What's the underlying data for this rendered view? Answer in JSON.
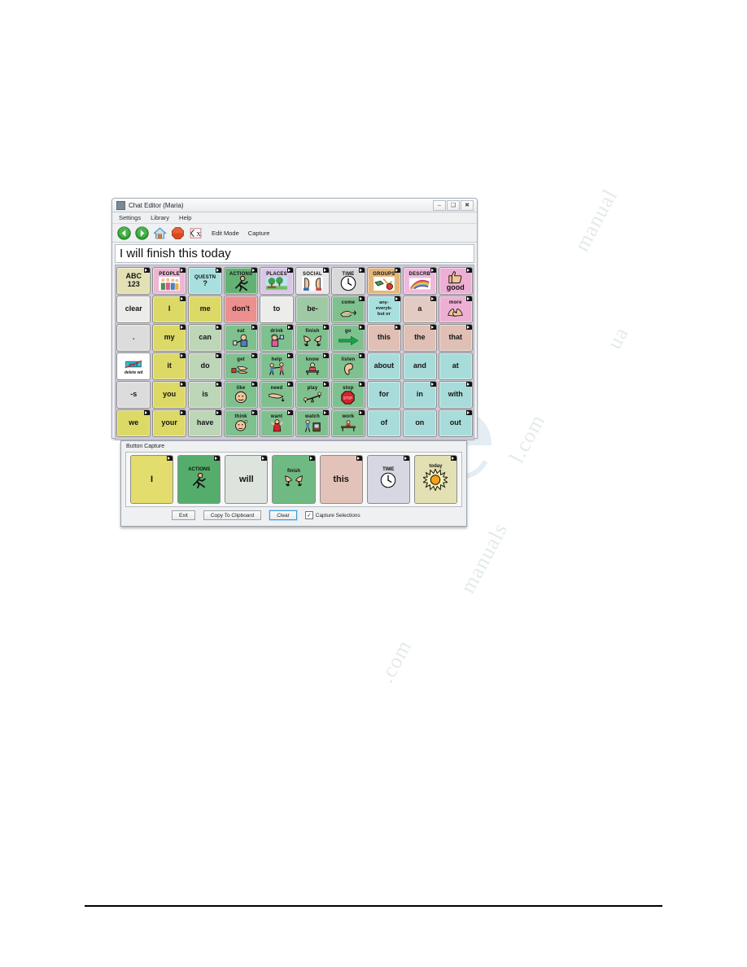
{
  "window": {
    "title": "Chat Editor (Maria)",
    "icon": "chat-editor-icon",
    "controls": {
      "minimize": "–",
      "maximize": "❑",
      "close": "✖"
    },
    "menu": [
      "Settings",
      "Library",
      "Help"
    ],
    "toolbar": {
      "icons": [
        "back-arrow-icon",
        "forward-arrow-icon",
        "home-icon",
        "stop-icon",
        "clear-display-icon"
      ],
      "labels": [
        "Edit Mode",
        "Capture"
      ]
    },
    "message_bar": {
      "text": "I will finish this today"
    }
  },
  "grid": {
    "columns": 10,
    "rows": 6,
    "cells": [
      {
        "label": "ABC",
        "label2": "123",
        "caption": "",
        "art": "",
        "color": "#e3e0b4",
        "corner": true
      },
      {
        "label": "",
        "caption": "PEOPLE",
        "art": "people-icon",
        "color": "#ecb7d2",
        "corner": true
      },
      {
        "label": "?",
        "caption": "QUESTN",
        "art": "",
        "color": "#a8e0df",
        "corner": true
      },
      {
        "label": "",
        "caption": "ACTIONS",
        "art": "running-person-icon",
        "color": "#63b174",
        "corner": true
      },
      {
        "label": "",
        "caption": "PLACES",
        "art": "park-scene-icon",
        "color": "#d9c6e6",
        "corner": true
      },
      {
        "label": "",
        "caption": "SOCIAL",
        "art": "two-faces-icon",
        "color": "#e8e8e8",
        "corner": true
      },
      {
        "label": "",
        "caption": "TIME",
        "art": "clock-icon",
        "color": "#d9d9d9",
        "corner": true
      },
      {
        "label": "",
        "caption": "GROUPS",
        "art": "objects-icon",
        "color": "#e3b77a",
        "corner": true
      },
      {
        "label": "",
        "caption": "DESCRB",
        "art": "rainbow-icon",
        "color": "#eeb9dd",
        "corner": true
      },
      {
        "label": "good",
        "caption": "",
        "art": "thumbs-up-icon",
        "color": "#eeafd4",
        "corner": true
      },
      {
        "label": "clear",
        "caption": "",
        "art": "",
        "color": "#ececeb",
        "corner": false
      },
      {
        "label": "I",
        "caption": "",
        "art": "",
        "color": "#dcd966",
        "corner": true
      },
      {
        "label": "me",
        "caption": "",
        "art": "",
        "color": "#dcd966",
        "corner": false
      },
      {
        "label": "don't",
        "caption": "",
        "art": "",
        "color": "#eb8f8f",
        "corner": false
      },
      {
        "label": "to",
        "caption": "",
        "art": "",
        "color": "#ececeb",
        "corner": false
      },
      {
        "label": "be-",
        "caption": "",
        "art": "",
        "color": "#9fc8a4",
        "corner": false
      },
      {
        "label": "",
        "caption": "come",
        "art": "hand-icon",
        "color": "#7fc08f",
        "corner": true
      },
      {
        "label": "any-\neveryb-\nbut or",
        "caption": "",
        "art": "",
        "color": "#a8e0df",
        "corner": true
      },
      {
        "label": "a",
        "caption": "",
        "art": "",
        "color": "#e3cbc3",
        "corner": true
      },
      {
        "label": "",
        "caption": "more",
        "art": "hands-icon",
        "color": "#eeafd4",
        "corner": true
      },
      {
        "label": ".",
        "caption": "",
        "art": "",
        "color": "#dcdcdc",
        "corner": false
      },
      {
        "label": "my",
        "caption": "",
        "art": "",
        "color": "#dcd966",
        "corner": true
      },
      {
        "label": "can",
        "caption": "",
        "art": "",
        "color": "#bcd6b7",
        "corner": true
      },
      {
        "label": "",
        "caption": "eat",
        "art": "eating-icon",
        "color": "#7fc08f",
        "corner": true
      },
      {
        "label": "",
        "caption": "drink",
        "art": "drinking-icon",
        "color": "#7fc08f",
        "corner": true
      },
      {
        "label": "",
        "caption": "finish",
        "art": "hands-down-icon",
        "color": "#7fc08f",
        "corner": true
      },
      {
        "label": "",
        "caption": "go",
        "art": "green-arrow-icon",
        "color": "#7fc08f",
        "corner": true
      },
      {
        "label": "this",
        "caption": "",
        "art": "",
        "color": "#e0bfb4",
        "corner": true
      },
      {
        "label": "the",
        "caption": "",
        "art": "",
        "color": "#e0bfb4",
        "corner": true
      },
      {
        "label": "that",
        "caption": "",
        "art": "",
        "color": "#e0bfb4",
        "corner": true
      },
      {
        "label": "delete wd",
        "caption": "",
        "art": "delete-word-icon",
        "color": "#ffffff",
        "corner": false
      },
      {
        "label": "it",
        "caption": "",
        "art": "",
        "color": "#dcd966",
        "corner": true
      },
      {
        "label": "do",
        "caption": "",
        "art": "",
        "color": "#bcd6b7",
        "corner": true
      },
      {
        "label": "",
        "caption": "get",
        "art": "grabbing-hands-icon",
        "color": "#7fc08f",
        "corner": true
      },
      {
        "label": "",
        "caption": "help",
        "art": "helping-icon",
        "color": "#7fc08f",
        "corner": true
      },
      {
        "label": "",
        "caption": "know",
        "art": "person-desk-icon",
        "color": "#7fc08f",
        "corner": true
      },
      {
        "label": "",
        "caption": "listen",
        "art": "ear-icon",
        "color": "#7fc08f",
        "corner": true
      },
      {
        "label": "about",
        "caption": "",
        "art": "",
        "color": "#a8dcda",
        "corner": false
      },
      {
        "label": "and",
        "caption": "",
        "art": "",
        "color": "#a8dcda",
        "corner": false
      },
      {
        "label": "at",
        "caption": "",
        "art": "",
        "color": "#a8dcda",
        "corner": false
      },
      {
        "label": "-s",
        "caption": "",
        "art": "",
        "color": "#dcdcdc",
        "corner": false
      },
      {
        "label": "you",
        "caption": "",
        "art": "",
        "color": "#dcd966",
        "corner": true
      },
      {
        "label": "is",
        "caption": "",
        "art": "",
        "color": "#bcd6b7",
        "corner": true
      },
      {
        "label": "",
        "caption": "like",
        "art": "face-icon",
        "color": "#7fc08f",
        "corner": true
      },
      {
        "label": "",
        "caption": "need",
        "art": "pointing-hand-icon",
        "color": "#7fc08f",
        "corner": true
      },
      {
        "label": "",
        "caption": "play",
        "art": "seesaw-icon",
        "color": "#7fc08f",
        "corner": true
      },
      {
        "label": "",
        "caption": "stop",
        "art": "stop-sign-icon",
        "color": "#7fc08f",
        "corner": true
      },
      {
        "label": "for",
        "caption": "",
        "art": "",
        "color": "#a8dcda",
        "corner": false
      },
      {
        "label": "in",
        "caption": "",
        "art": "",
        "color": "#a8dcda",
        "corner": true
      },
      {
        "label": "with",
        "caption": "",
        "art": "",
        "color": "#a8dcda",
        "corner": true
      },
      {
        "label": "we",
        "caption": "",
        "art": "",
        "color": "#dcd966",
        "corner": true
      },
      {
        "label": "your",
        "caption": "",
        "art": "",
        "color": "#dcd966",
        "corner": true
      },
      {
        "label": "have",
        "caption": "",
        "art": "",
        "color": "#bcd6b7",
        "corner": true
      },
      {
        "label": "",
        "caption": "think",
        "art": "thinking-face-icon",
        "color": "#7fc08f",
        "corner": true
      },
      {
        "label": "",
        "caption": "want",
        "art": "wanting-person-icon",
        "color": "#7fc08f",
        "corner": true
      },
      {
        "label": "",
        "caption": "watch",
        "art": "person-tv-icon",
        "color": "#7fc08f",
        "corner": true
      },
      {
        "label": "",
        "caption": "work",
        "art": "desk-work-icon",
        "color": "#7fc08f",
        "corner": true
      },
      {
        "label": "of",
        "caption": "",
        "art": "",
        "color": "#a8dcda",
        "corner": false
      },
      {
        "label": "on",
        "caption": "",
        "art": "",
        "color": "#a8dcda",
        "corner": false
      },
      {
        "label": "out",
        "caption": "",
        "art": "",
        "color": "#a8dcda",
        "corner": true
      }
    ]
  },
  "button_capture": {
    "title": "Button Capture",
    "cells": [
      {
        "label": "I",
        "caption": "",
        "art": "",
        "color": "#e2dd6d"
      },
      {
        "label": "",
        "caption": "ACTIONS",
        "art": "running-person-icon",
        "color": "#55ad6c"
      },
      {
        "label": "will",
        "caption": "",
        "art": "",
        "color": "#dde3dd"
      },
      {
        "label": "",
        "caption": "finish",
        "art": "hands-down-icon",
        "color": "#6fba83"
      },
      {
        "label": "this",
        "caption": "",
        "art": "",
        "color": "#e3c3b9"
      },
      {
        "label": "",
        "caption": "TIME",
        "art": "clock-icon",
        "color": "#d7d7e3"
      },
      {
        "label": "",
        "caption": "today",
        "art": "sun-icon",
        "color": "#e3e0b4"
      }
    ],
    "buttons": [
      {
        "label": "Exit",
        "focused": false
      },
      {
        "label": "Copy To Clipboard",
        "focused": false
      },
      {
        "label": "Clear",
        "focused": true
      }
    ],
    "checkbox": {
      "label": "Capture Selections",
      "checked": true,
      "mark": "✓"
    }
  },
  "watermark": {
    "lines": [
      "manualua",
      "l.com",
      "manuals.com"
    ]
  }
}
